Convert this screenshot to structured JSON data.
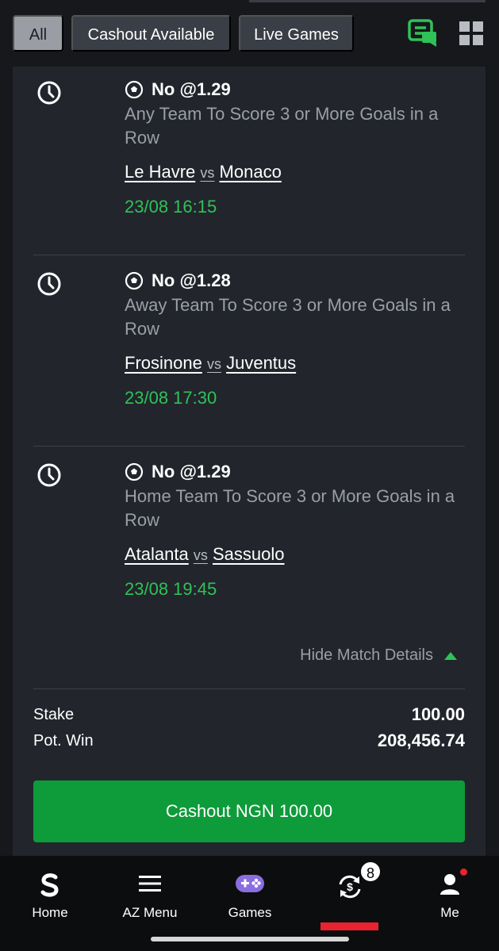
{
  "filters": {
    "all": "All",
    "cashout_available": "Cashout Available",
    "live_games": "Live Games"
  },
  "toolbar": {
    "chat_icon": "chat-bubble-icon",
    "grid_icon": "grid-view-icon"
  },
  "matches": [
    {
      "pick": "No @1.29",
      "market": "Any Team To Score 3 or More Goals in a Row",
      "home": "Le Havre",
      "vs": "vs",
      "away": "Monaco",
      "datetime": "23/08 16:15"
    },
    {
      "pick": "No @1.28",
      "market": "Away Team To Score 3 or More Goals in a Row",
      "home": "Frosinone",
      "vs": "vs",
      "away": "Juventus",
      "datetime": "23/08 17:30"
    },
    {
      "pick": "No @1.29",
      "market": "Home Team To Score 3 or More Goals in a Row",
      "home": "Atalanta",
      "vs": "vs",
      "away": "Sassuolo",
      "datetime": "23/08 19:45"
    }
  ],
  "details": {
    "hide_label": "Hide Match Details"
  },
  "summary": {
    "stake_label": "Stake",
    "stake_value": "100.00",
    "potwin_label": "Pot. Win",
    "potwin_value": "208,456.74"
  },
  "cashout": {
    "label": "Cashout NGN 100.00"
  },
  "nav": {
    "home": "Home",
    "az_menu": "AZ Menu",
    "games": "Games",
    "cashout_badge": "8",
    "me": "Me"
  },
  "colors": {
    "accent_green": "#2fc257",
    "button_green": "#0e9b3a",
    "active_red": "#e8232f",
    "card_bg": "#22252c"
  }
}
